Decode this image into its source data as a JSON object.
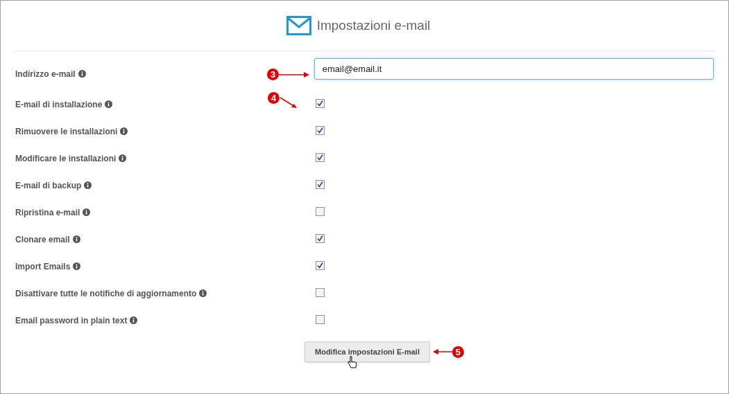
{
  "title": "Impostazioni e-mail",
  "email_field": {
    "label": "Indirizzo e-mail",
    "value": "email@email.it"
  },
  "options": [
    {
      "label": "E-mail di installazione",
      "checked": true
    },
    {
      "label": "Rimuovere le installazioni",
      "checked": true
    },
    {
      "label": "Modificare le installazioni",
      "checked": true
    },
    {
      "label": "E-mail di backup",
      "checked": true
    },
    {
      "label": "Ripristina e-mail",
      "checked": false
    },
    {
      "label": "Clonare email",
      "checked": true
    },
    {
      "label": "Import Emails",
      "checked": true
    },
    {
      "label": "Disattivare tutte le notifiche di aggiornamento",
      "checked": false
    },
    {
      "label": "Email password in plain text",
      "checked": false
    }
  ],
  "submit_button": "Modifica impostazioni E-mail",
  "callouts": [
    "3",
    "4",
    "5"
  ]
}
